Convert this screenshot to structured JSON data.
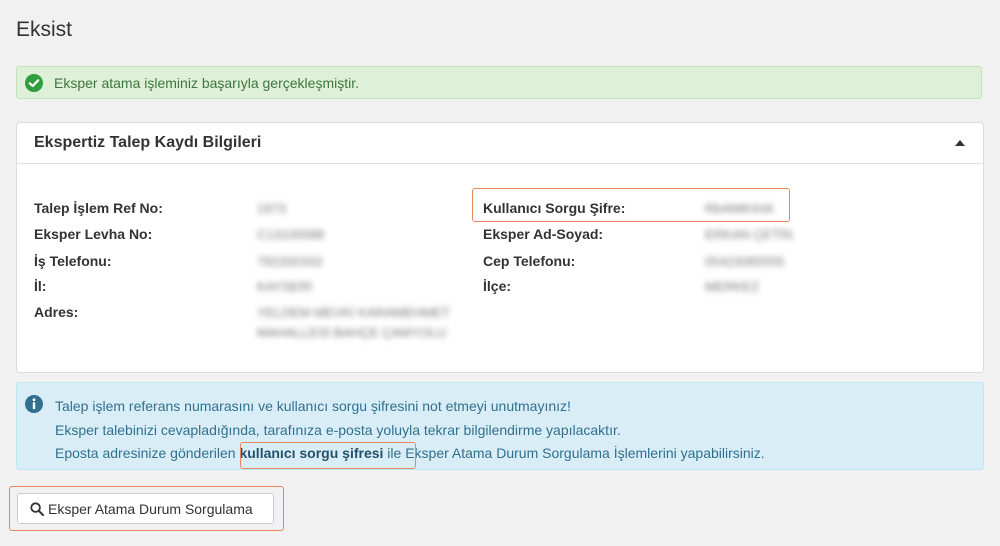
{
  "page": {
    "title": "Eksist"
  },
  "success_alert": {
    "message": "Eksper atama işleminiz başarıyla gerçekleşmiştir."
  },
  "panel": {
    "title": "Ekspertiz Talep Kaydı Bilgileri",
    "left_fields": [
      {
        "label": "Talep İşlem Ref No:",
        "value": "1973"
      },
      {
        "label": "Eksper Levha No:",
        "value": "C13100088"
      },
      {
        "label": "İş Telefonu:",
        "value": "782200333"
      },
      {
        "label": "İl:",
        "value": "KAYSERİ"
      },
      {
        "label": "Adres:",
        "value_lines": [
          "YELDEM MEVKİ KARAMEHMET",
          "MAHALLESİ BAHÇE ÇAMYOLU"
        ]
      }
    ],
    "right_fields": [
      {
        "label": "Kullanıcı Sorgu Şifre:",
        "value": "Rb4IMKIHA"
      },
      {
        "label": "Eksper Ad-Soyad:",
        "value": "ERKAN ÇETİN"
      },
      {
        "label": "Cep Telefonu:",
        "value": "05423085555"
      },
      {
        "label": "İlçe:",
        "value": "MERKEZ"
      }
    ]
  },
  "info_alert": {
    "line1": "Talep işlem referans numarasını ve kullanıcı sorgu şifresini not etmeyi unutmayınız!",
    "line2": "Eksper talebinizi cevapladığında, tarafınıza e-posta yoluyla tekrar bilgilendirme yapılacaktır.",
    "line3_prefix": "Eposta adresinize gönderilen ",
    "line3_link": "kullanıcı sorgu şifresi",
    "line3_suffix": " ile Eksper Atama Durum Sorgulama İşlemlerini yapabilirsiniz."
  },
  "query_button": {
    "label": "Eksper Atama Durum Sorgulama",
    "icon": "search-icon"
  },
  "colors": {
    "success_bg": "#dff0d8",
    "success_text": "#3c763d",
    "info_bg": "#d9edf7",
    "info_text": "#31708f",
    "highlight": "#e8875d"
  }
}
